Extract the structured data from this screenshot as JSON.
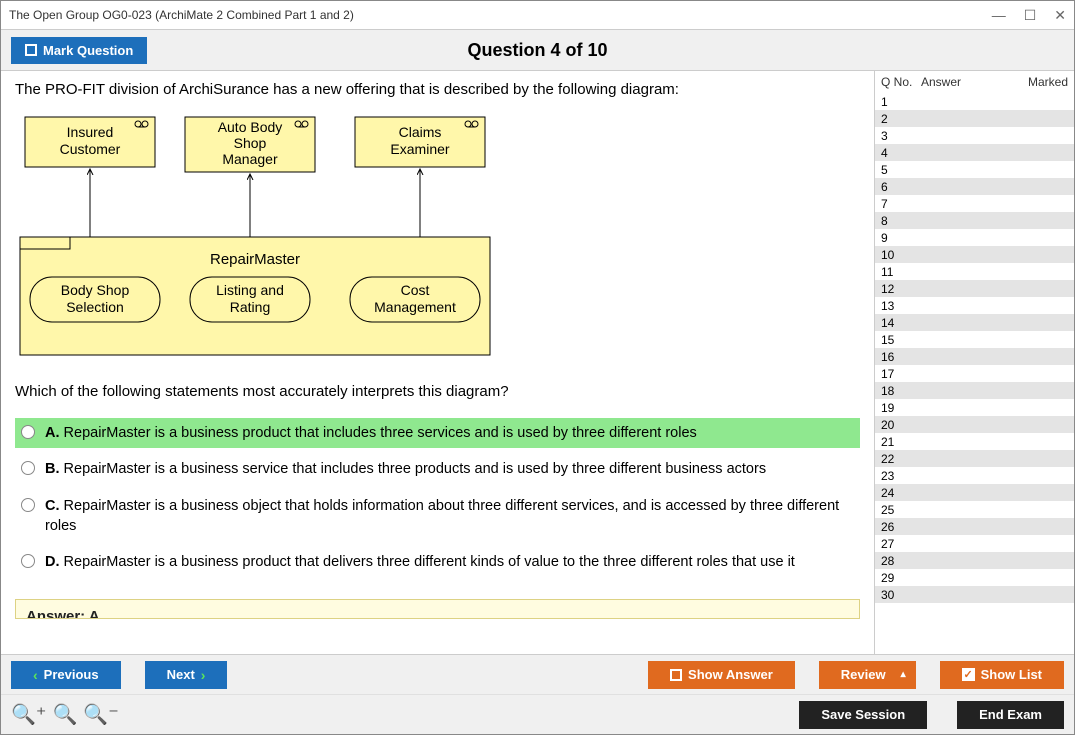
{
  "window": {
    "title": "The Open Group OG0-023 (ArchiMate 2 Combined Part 1 and 2)"
  },
  "topbar": {
    "mark_label": "Mark Question",
    "question_title": "Question 4 of 10"
  },
  "question": {
    "stem": "The PRO-FIT division of ArchiSurance has a new offering that is described by the following diagram:",
    "sub": "Which of the following statements most accurately interprets this diagram?",
    "diagram": {
      "roles": [
        "Insured Customer",
        "Auto Body Shop Manager",
        "Claims Examiner"
      ],
      "product": "RepairMaster",
      "services": [
        "Body Shop Selection",
        "Listing and Rating",
        "Cost Management"
      ]
    },
    "options": [
      {
        "letter": "A.",
        "text": "RepairMaster is a business product that includes three services and is used by three different roles",
        "correct": true
      },
      {
        "letter": "B.",
        "text": "RepairMaster is a business service that includes three products and is used by three different business actors",
        "correct": false
      },
      {
        "letter": "C.",
        "text": "RepairMaster is a business object that holds information about three different services, and is accessed by three different roles",
        "correct": false
      },
      {
        "letter": "D.",
        "text": "RepairMaster is a business product that delivers three different kinds of value to the three different roles that use it",
        "correct": false
      }
    ],
    "answer_label": "Answer: A"
  },
  "qlist": {
    "head": {
      "no": "Q No.",
      "answer": "Answer",
      "marked": "Marked"
    },
    "rows": [
      1,
      2,
      3,
      4,
      5,
      6,
      7,
      8,
      9,
      10,
      11,
      12,
      13,
      14,
      15,
      16,
      17,
      18,
      19,
      20,
      21,
      22,
      23,
      24,
      25,
      26,
      27,
      28,
      29,
      30
    ]
  },
  "buttons": {
    "previous": "Previous",
    "next": "Next",
    "show_answer": "Show Answer",
    "review": "Review",
    "show_list": "Show List",
    "save_session": "Save Session",
    "end_exam": "End Exam"
  }
}
